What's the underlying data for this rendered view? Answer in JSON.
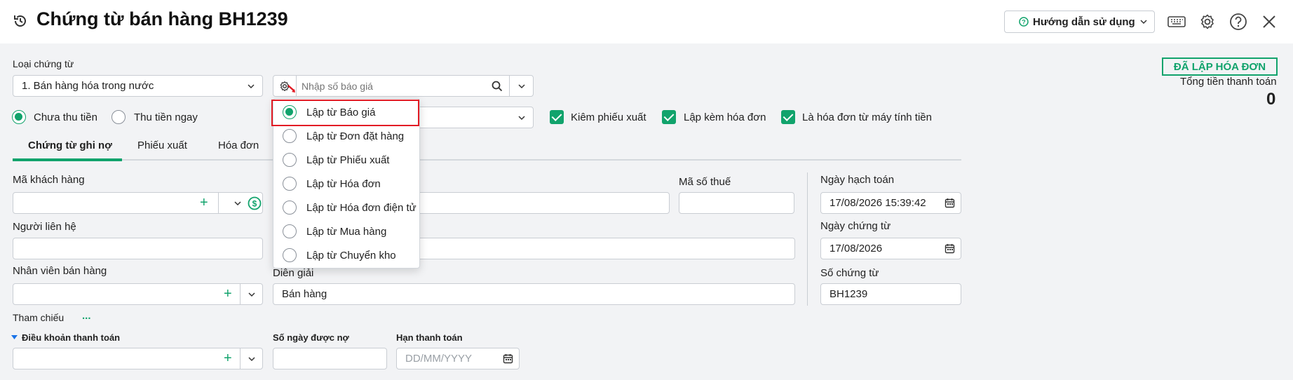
{
  "header": {
    "title": "Chứng từ bán hàng BH1239",
    "help_label": "Hướng dẫn sử dụng"
  },
  "status": {
    "badge": "ĐÃ LẬP HÓA ĐƠN",
    "total_label": "Tổng tiền thanh toán",
    "total_value": "0"
  },
  "voucher_type": {
    "label": "Loại chứng từ",
    "value": "1. Bán hàng hóa trong nước"
  },
  "quote_search": {
    "placeholder": "Nhập số báo giá"
  },
  "payment": {
    "options": [
      "Chưa thu tiền",
      "Thu tiền ngay"
    ],
    "selected": "Chưa thu tiền"
  },
  "checkboxes": [
    {
      "label": "Kiêm phiếu xuất",
      "checked": true
    },
    {
      "label": "Lập kèm hóa đơn",
      "checked": true
    },
    {
      "label": "Là hóa đơn từ máy tính tiền",
      "checked": true
    }
  ],
  "tabs": [
    "Chứng từ ghi nợ",
    "Phiếu xuất",
    "Hóa đơn"
  ],
  "dropdown_menu": {
    "items": [
      "Lập từ Báo giá",
      "Lập từ Đơn đặt hàng",
      "Lập từ Phiếu xuất",
      "Lập từ Hóa đơn",
      "Lập từ Hóa đơn điện tử",
      "Lập từ Mua hàng",
      "Lập từ Chuyển kho"
    ],
    "selected": "Lập từ Báo giá"
  },
  "form": {
    "customer_code_label": "Mã khách hàng",
    "tax_code_label": "Mã số thuế",
    "contact_label": "Người liên hệ",
    "salesperson_label": "Nhân viên bán hàng",
    "description_label": "Diễn giải",
    "description_value": "Bán hàng",
    "reference_label": "Tham chiếu",
    "reference_more": "...",
    "payment_terms_label": "Điều khoản thanh toán",
    "credit_days_label": "Số ngày được nợ",
    "due_date_label": "Hạn thanh toán",
    "due_date_placeholder": "DD/MM/YYYY"
  },
  "dates": {
    "posting_date_label": "Ngày hạch toán",
    "posting_date_value": "17/08/2026 15:39:42",
    "voucher_date_label": "Ngày chứng từ",
    "voucher_date_value": "17/08/2026",
    "voucher_no_label": "Số chứng từ",
    "voucher_no_value": "BH1239"
  },
  "colors": {
    "accent": "#11a36c",
    "highlight": "#e21b24"
  }
}
